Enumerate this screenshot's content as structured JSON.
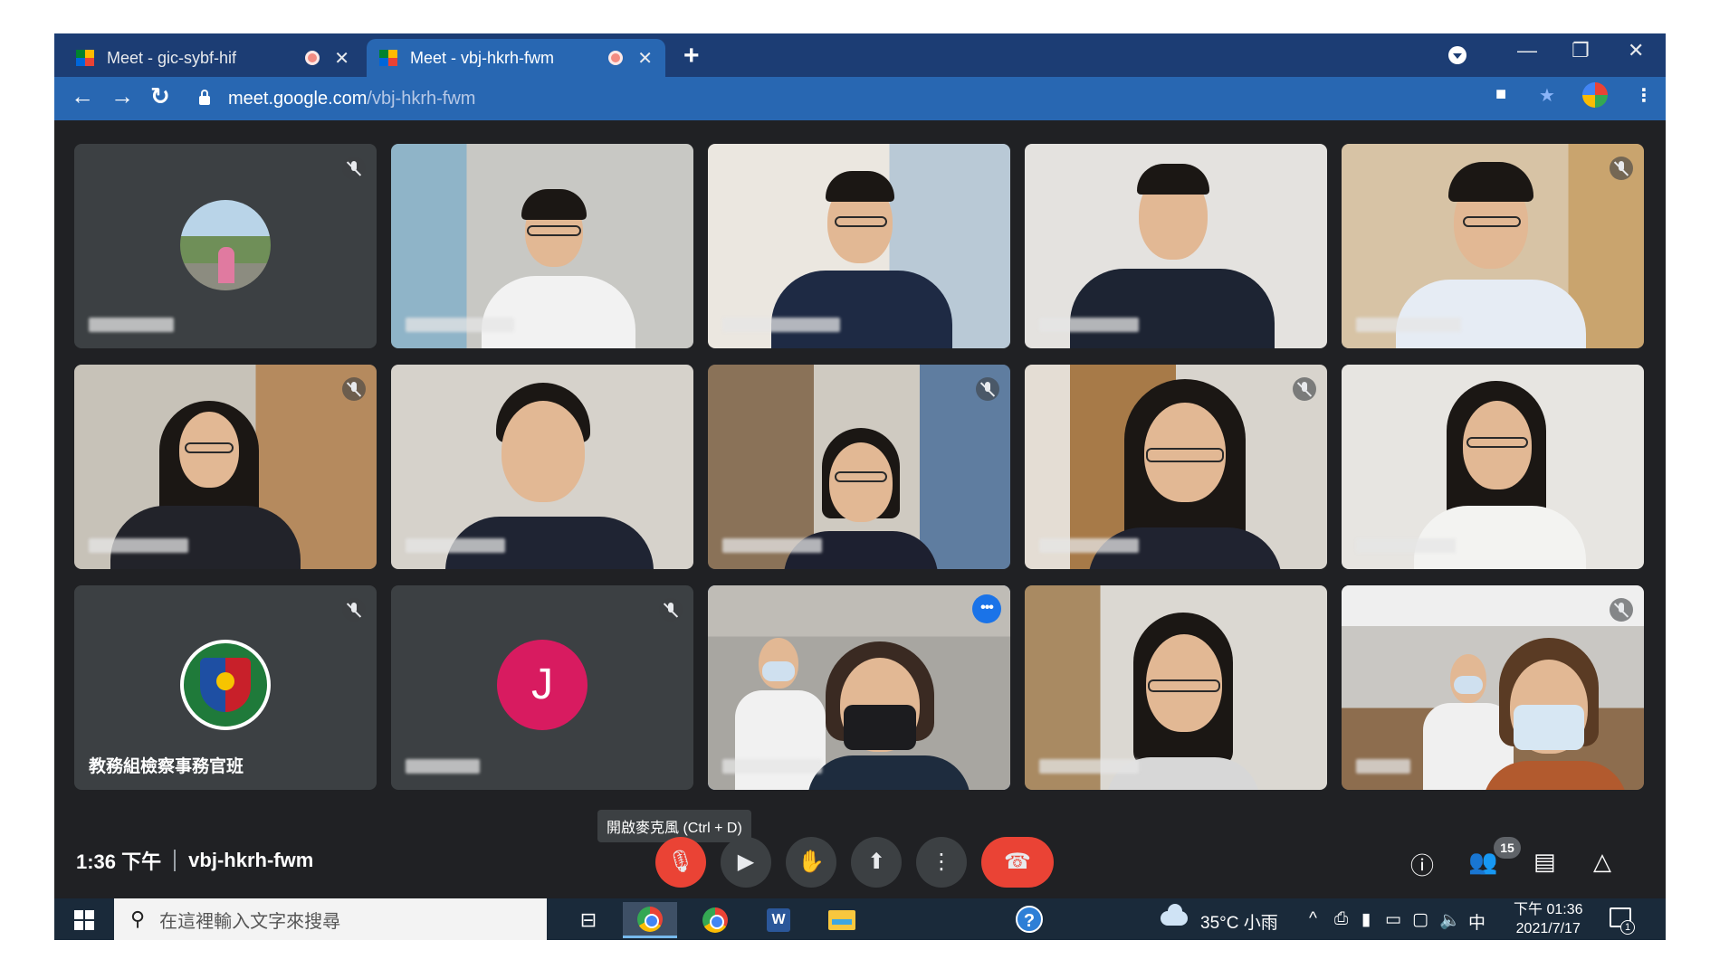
{
  "browser": {
    "tabs": [
      {
        "title": "Meet - gic-sybf-hif",
        "active": false
      },
      {
        "title": "Meet - vbj-hkrh-fwm",
        "active": true
      }
    ],
    "new_tab_label": "+",
    "url_host": "meet.google.com",
    "url_path": "/vbj-hkrh-fwm"
  },
  "meeting": {
    "time": "1:36 下午",
    "code": "vbj-hkrh-fwm",
    "tooltip": "開啟麥克風 (Ctrl + D)",
    "participant_count": "15",
    "avatar_letter": "J",
    "named_tile_label": "教務組檢察事務官班"
  },
  "taskbar": {
    "search_placeholder": "在這裡輸入文字來搜尋",
    "weather": "35°C 小雨",
    "ime": "中",
    "time": "下午 01:36",
    "date": "2021/7/17",
    "notification_count": "1",
    "word_letter": "W",
    "help_label": "?"
  },
  "colors": {
    "tabstrip": "#1c3d74",
    "toolbar": "#2867b2",
    "meet_bg": "#202124",
    "tile_bg": "#3c4043",
    "mic_off_red": "#ea4335",
    "speaker_outline": "#8ab4f8",
    "avatar_j": "#d81b60"
  }
}
